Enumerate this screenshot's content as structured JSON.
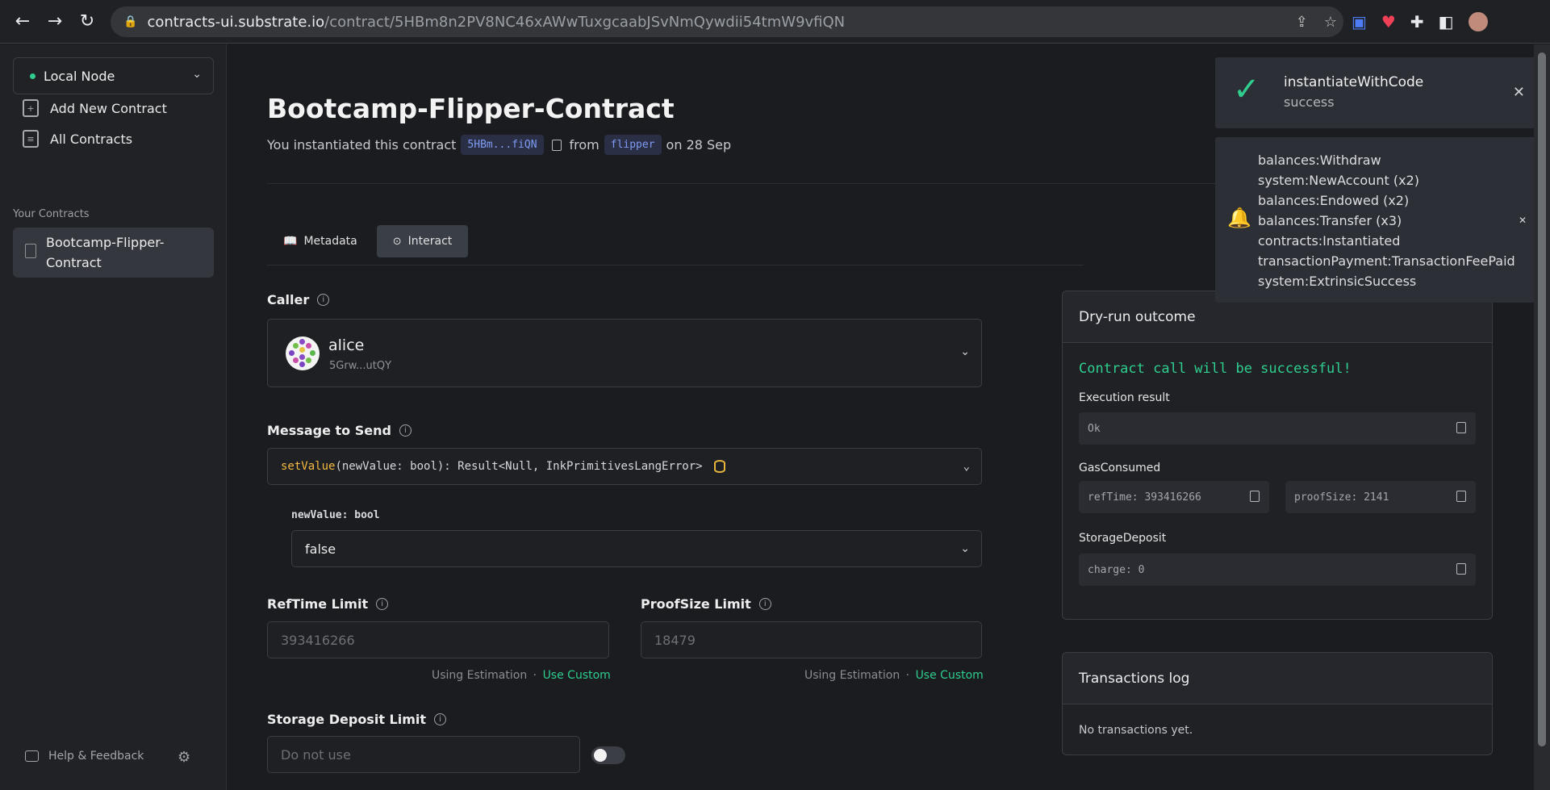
{
  "browser": {
    "url_host": "contracts-ui.substrate.io",
    "url_path": "/contract/5HBm8n2PV8NC46xAWwTuxgcaabJSvNmQywdii54tmW9vfiQN"
  },
  "sidebar": {
    "network": "Local Node",
    "links": [
      {
        "label": "Add New Contract",
        "icon": "file-plus-icon"
      },
      {
        "label": "All Contracts",
        "icon": "stack-icon"
      }
    ],
    "your_contracts_label": "Your Contracts",
    "contracts": [
      "Bootcamp-Flipper-Contract"
    ],
    "help_label": "Help & Feedback"
  },
  "contract": {
    "title": "Bootcamp-Flipper-Contract",
    "instantiated_text": "You instantiated this contract",
    "address_short": "5HBm...fiQN",
    "from_text": "from",
    "code_name": "flipper",
    "date_text": "on 28 Sep"
  },
  "tabs": [
    {
      "label": "Metadata",
      "active": false
    },
    {
      "label": "Interact",
      "active": true
    }
  ],
  "interact": {
    "caller_label": "Caller",
    "caller_name": "alice",
    "caller_address": "5Grw...utQY",
    "message_label": "Message to Send",
    "message_fn": "setValue",
    "message_sig": "(newValue: bool): Result<Null, InkPrimitivesLangError>",
    "param_label": "newValue: bool",
    "param_value": "false",
    "reftime_label": "RefTime Limit",
    "reftime_placeholder": "393416266",
    "proofsize_label": "ProofSize Limit",
    "proofsize_placeholder": "18479",
    "estimation_text": "Using Estimation",
    "separator": "·",
    "use_custom": "Use Custom",
    "storage_label": "Storage Deposit Limit",
    "storage_placeholder": "Do not use"
  },
  "dry_run": {
    "title": "Dry-run outcome",
    "status": "Contract call will be successful!",
    "execution_label": "Execution result",
    "execution_value": "Ok",
    "gas_label": "GasConsumed",
    "reftime_value": "refTime: 393416266",
    "proofsize_value": "proofSize: 2141",
    "storage_label": "StorageDeposit",
    "storage_value": "charge: 0"
  },
  "transactions": {
    "title": "Transactions log",
    "empty_text": "No transactions yet."
  },
  "toasts": {
    "success_title": "instantiateWithCode",
    "success_sub": "success",
    "events": [
      "balances:Withdraw",
      "system:NewAccount (x2)",
      "balances:Endowed (x2)",
      "balances:Transfer (x3)",
      "contracts:Instantiated",
      "transactionPayment:TransactionFeePaid",
      "system:ExtrinsicSuccess"
    ]
  },
  "colors": {
    "accent_green": "#2fce8f",
    "warning_yellow": "#f4b942",
    "chip_blue": "#7f9cf5"
  }
}
